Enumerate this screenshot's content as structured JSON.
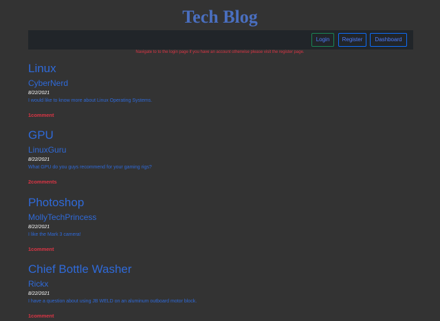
{
  "site": {
    "title": "Tech Blog"
  },
  "nav": {
    "login": "Login",
    "register": "Register",
    "dashboard": "Dashboard"
  },
  "hint": "Navigate to to the login page if you have an account otherwise please visit the register page.",
  "colors": {
    "background": "#333333",
    "navbar": "#212529",
    "link_blue": "#2f6ad9",
    "title_blue": "#4a6fc0",
    "danger_red": "#dc3545"
  },
  "posts": [
    {
      "title": "Linux",
      "author": "CyberNerd",
      "date": "8/22/2021",
      "body": "I would like to know more about Linux Operating Systems.",
      "comments": "1comment"
    },
    {
      "title": "GPU",
      "author": "LinuxGuru",
      "date": "8/22/2021",
      "body": "What GPU do you guys recommend for your gaming rigs?",
      "comments": "2comments"
    },
    {
      "title": "Photoshop",
      "author": "MollyTechPrincess",
      "date": "8/22/2021",
      "body": "I like the Mark 3 camera!",
      "comments": "1comment"
    },
    {
      "title": "Chief Bottle Washer",
      "author": "Rickx",
      "date": "8/22/2021",
      "body": "I have a question about using JB WELD on an aluminum outboard motor block.",
      "comments": "1comment"
    }
  ]
}
